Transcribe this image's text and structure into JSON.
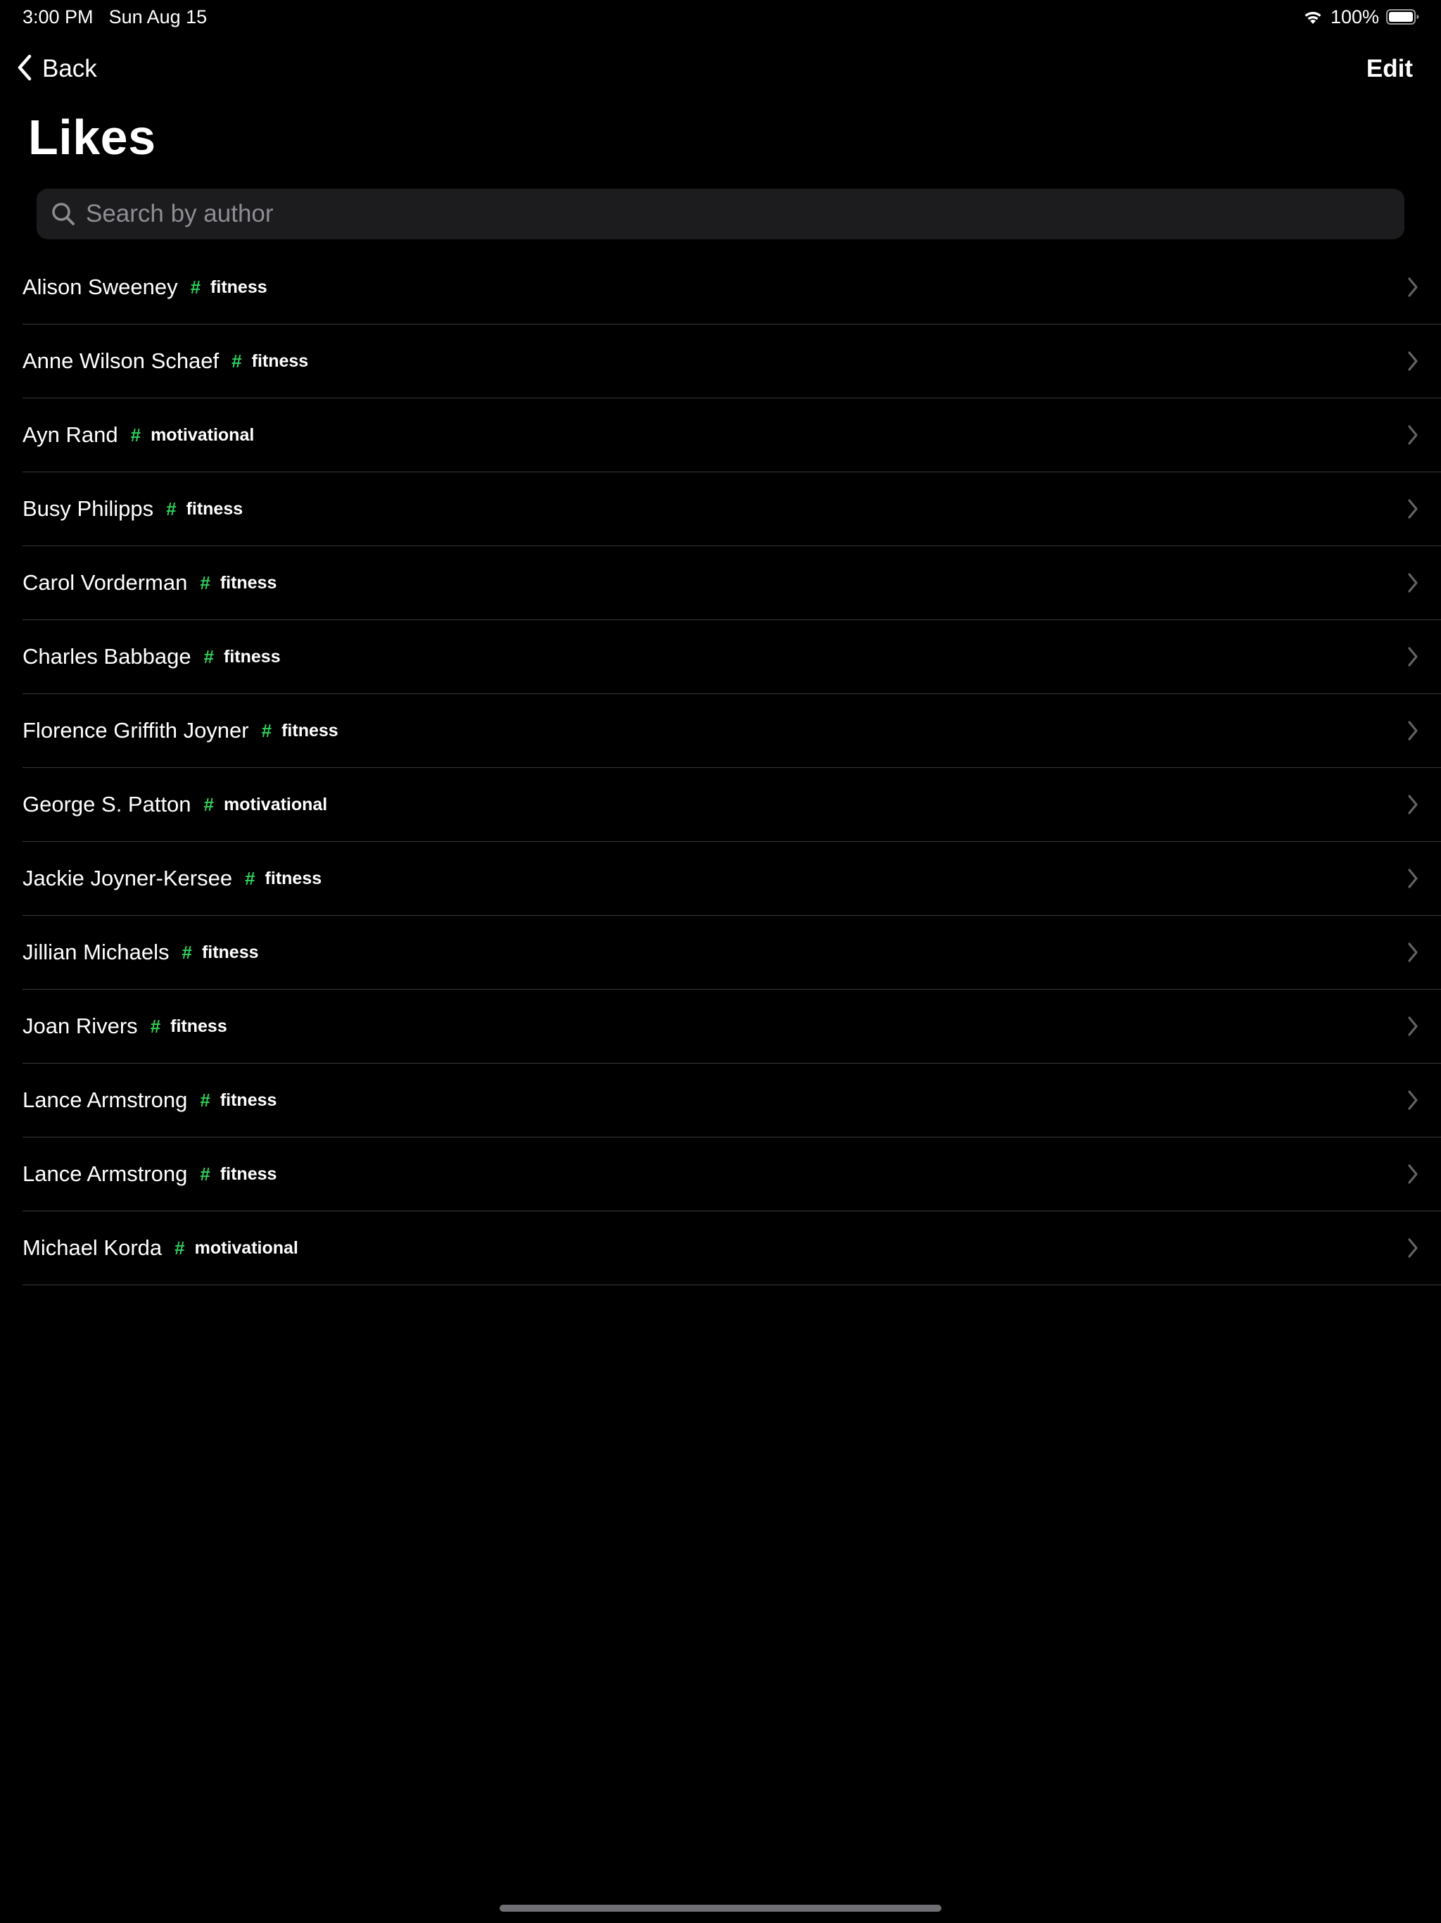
{
  "status_bar": {
    "time": "3:00 PM",
    "date": "Sun Aug 15",
    "battery": "100%",
    "icons": [
      "wifi-icon",
      "battery-icon"
    ]
  },
  "nav": {
    "back_label": "Back",
    "edit_label": "Edit"
  },
  "title": "Likes",
  "search": {
    "placeholder": "Search by author",
    "value": ""
  },
  "colors": {
    "background": "#000000",
    "hash_accent": "#30d158",
    "separator": "#38383a",
    "search_bg": "#1c1c1e"
  },
  "items": [
    {
      "author": "Alison Sweeney",
      "hash": "#",
      "tag": "fitness"
    },
    {
      "author": "Anne Wilson Schaef",
      "hash": "#",
      "tag": "fitness"
    },
    {
      "author": "Ayn Rand",
      "hash": "#",
      "tag": "motivational"
    },
    {
      "author": "Busy Philipps",
      "hash": "#",
      "tag": "fitness"
    },
    {
      "author": "Carol Vorderman",
      "hash": "#",
      "tag": "fitness"
    },
    {
      "author": "Charles Babbage",
      "hash": "#",
      "tag": "fitness"
    },
    {
      "author": "Florence Griffith Joyner",
      "hash": "#",
      "tag": "fitness"
    },
    {
      "author": "George S. Patton",
      "hash": "#",
      "tag": "motivational"
    },
    {
      "author": "Jackie Joyner-Kersee",
      "hash": "#",
      "tag": "fitness"
    },
    {
      "author": "Jillian Michaels",
      "hash": "#",
      "tag": "fitness"
    },
    {
      "author": "Joan Rivers",
      "hash": "#",
      "tag": "fitness"
    },
    {
      "author": "Lance Armstrong",
      "hash": "#",
      "tag": "fitness"
    },
    {
      "author": "Lance Armstrong",
      "hash": "#",
      "tag": "fitness"
    },
    {
      "author": "Michael Korda",
      "hash": "#",
      "tag": "motivational"
    }
  ]
}
